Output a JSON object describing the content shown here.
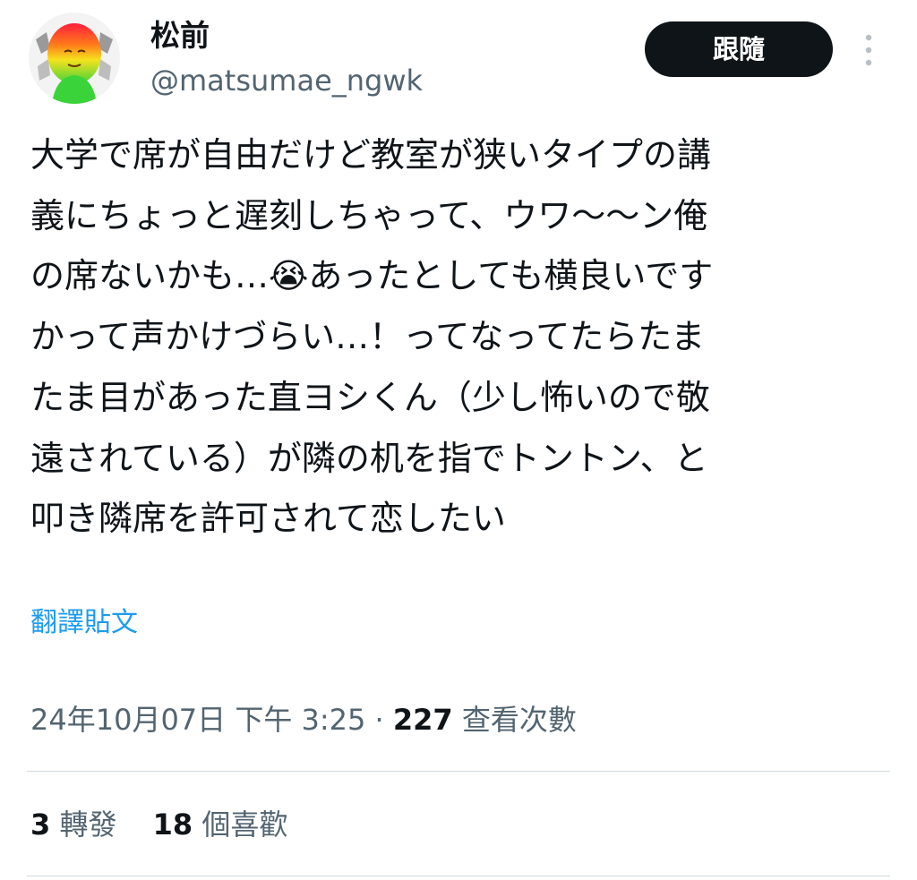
{
  "author": {
    "display_name": "松前",
    "handle": "@matsumae_ngwk",
    "avatar_icon": "avatar-icon"
  },
  "actions": {
    "follow_label": "跟隨",
    "more_icon": "more-vertical-icon"
  },
  "tweet": {
    "text": "大学で席が自由だけど教室が狭いタイプの講\n義にちょっと遅刻しちゃって、ウワ〜〜ン俺\nの席ないかも…😭あったとしても横良いです\nかって声かけづらい…！ってなってたらたま\nたま目があった直ヨシくん（少し怖いので敬\n遠されている）が隣の机を指でトントン、と\n叩き隣席を許可されて恋したい",
    "translate_label": "翻譯貼文"
  },
  "meta": {
    "timestamp": "24年10月07日 下午 3:25",
    "separator": "·",
    "views_count": "227",
    "views_label": "查看次數"
  },
  "stats": {
    "retweets_count": "3",
    "retweets_label": "轉發",
    "likes_count": "18",
    "likes_label": "個喜歡"
  },
  "colors": {
    "text_primary": "#0f1419",
    "text_secondary": "#536471",
    "link": "#1d9bf0",
    "divider": "#cfd9de",
    "follow_bg": "#0f1419"
  }
}
